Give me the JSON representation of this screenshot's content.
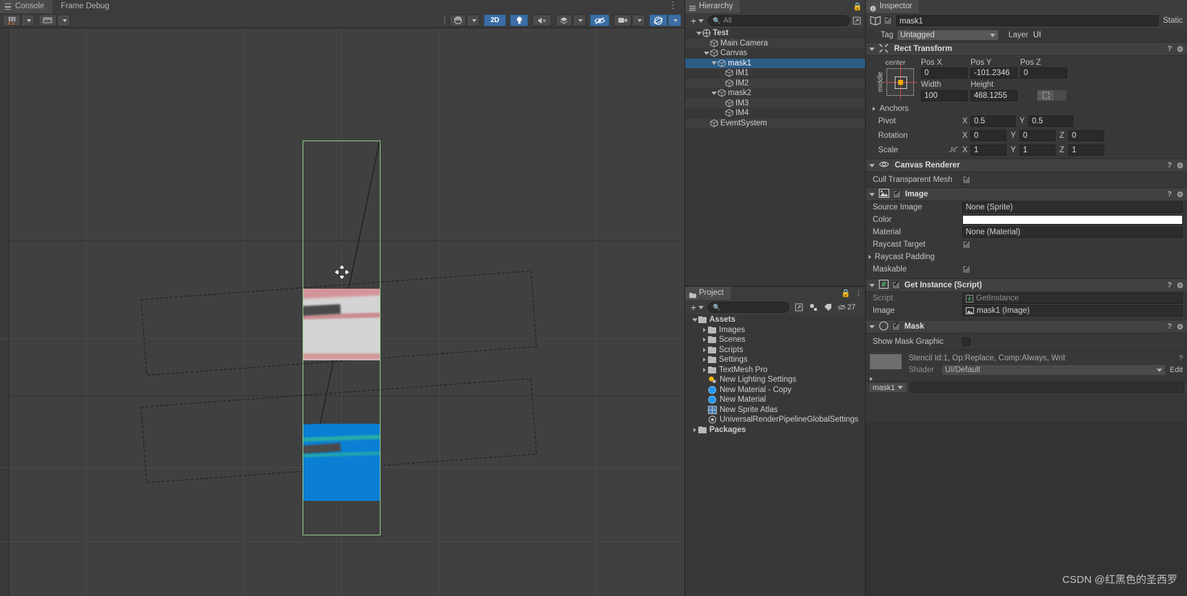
{
  "console": {
    "tabs": [
      {
        "label": "Console",
        "icon": "console-icon",
        "active": true
      },
      {
        "label": "Frame Debug",
        "icon": "",
        "active": false
      }
    ]
  },
  "scene_toolbar": {
    "left_buttons": [
      {
        "name": "snap-grid-toggle",
        "glyph": "#",
        "dropdown": true
      },
      {
        "name": "grid-snapping",
        "glyph": "|||",
        "dropdown": true
      }
    ],
    "right_buttons": [
      {
        "name": "draw-mode",
        "label": "shaded-globe",
        "dropdown": true,
        "active": false
      },
      {
        "name": "2d-toggle",
        "label": "2D",
        "active": true
      },
      {
        "name": "lighting-toggle",
        "label": "bulb",
        "active": true
      },
      {
        "name": "audio-toggle",
        "label": "audio-mute",
        "active": false
      },
      {
        "name": "effects-toggle",
        "label": "fx",
        "dropdown": true,
        "active": false
      },
      {
        "name": "hidden-objects-toggle",
        "label": "eye-off",
        "active": true
      },
      {
        "name": "camera-toggle",
        "label": "camera",
        "dropdown": true,
        "active": false
      },
      {
        "name": "gizmos-toggle",
        "label": "gizmos",
        "dropdown": true,
        "active": true
      }
    ]
  },
  "hierarchy": {
    "tab_label": "Hierarchy",
    "search_placeholder": "All",
    "add_label": "+",
    "items": [
      {
        "label": "Test",
        "depth": 0,
        "expanded": true,
        "icon": "scene-icon",
        "selected": false,
        "bold": true
      },
      {
        "label": "Main Camera",
        "depth": 1,
        "expanded": null,
        "icon": "gameobject-icon",
        "selected": false
      },
      {
        "label": "Canvas",
        "depth": 1,
        "expanded": true,
        "icon": "gameobject-icon",
        "selected": false
      },
      {
        "label": "mask1",
        "depth": 2,
        "expanded": true,
        "icon": "gameobject-icon",
        "selected": true
      },
      {
        "label": "IM1",
        "depth": 3,
        "expanded": null,
        "icon": "gameobject-icon",
        "selected": false
      },
      {
        "label": "IM2",
        "depth": 3,
        "expanded": null,
        "icon": "gameobject-icon",
        "selected": false
      },
      {
        "label": "mask2",
        "depth": 2,
        "expanded": true,
        "icon": "gameobject-icon",
        "selected": false
      },
      {
        "label": "IM3",
        "depth": 3,
        "expanded": null,
        "icon": "gameobject-icon",
        "selected": false
      },
      {
        "label": "IM4",
        "depth": 3,
        "expanded": null,
        "icon": "gameobject-icon",
        "selected": false
      },
      {
        "label": "EventSystem",
        "depth": 1,
        "expanded": null,
        "icon": "gameobject-icon",
        "selected": false
      }
    ]
  },
  "project": {
    "tab_label": "Project",
    "search_placeholder": "",
    "add_label": "+",
    "visible_count": "27",
    "items": [
      {
        "label": "Assets",
        "depth": 0,
        "expanded": true,
        "icon": "folder-icon",
        "bold": true
      },
      {
        "label": "Images",
        "depth": 1,
        "expanded": false,
        "icon": "folder-icon"
      },
      {
        "label": "Scenes",
        "depth": 1,
        "expanded": false,
        "icon": "folder-icon"
      },
      {
        "label": "Scripts",
        "depth": 1,
        "expanded": false,
        "icon": "folder-icon"
      },
      {
        "label": "Settings",
        "depth": 1,
        "expanded": false,
        "icon": "folder-icon"
      },
      {
        "label": "TextMesh Pro",
        "depth": 1,
        "expanded": false,
        "icon": "folder-icon"
      },
      {
        "label": "New Lighting Settings",
        "depth": 1,
        "expanded": null,
        "icon": "lighting-settings-icon"
      },
      {
        "label": "New Material - Copy",
        "depth": 1,
        "expanded": null,
        "icon": "material-icon"
      },
      {
        "label": "New Material",
        "depth": 1,
        "expanded": null,
        "icon": "material-icon"
      },
      {
        "label": "New Sprite Atlas",
        "depth": 1,
        "expanded": null,
        "icon": "sprite-atlas-icon"
      },
      {
        "label": "UniversalRenderPipelineGlobalSettings",
        "depth": 1,
        "expanded": null,
        "icon": "asset-icon"
      },
      {
        "label": "Packages",
        "depth": 0,
        "expanded": false,
        "icon": "folder-icon",
        "bold": true
      }
    ]
  },
  "inspector": {
    "tab_label": "Inspector",
    "object_name": "mask1",
    "object_enabled": true,
    "static_label": "Static",
    "tag_label": "Tag",
    "tag_value": "Untagged",
    "layer_label": "Layer",
    "layer_value": "UI",
    "rect_transform": {
      "title": "Rect Transform",
      "anchor_preset_top": "center",
      "anchor_preset_side": "middle",
      "headers": [
        "Pos X",
        "Pos Y",
        "Pos Z"
      ],
      "pos": [
        "0",
        "-101.2346",
        "0"
      ],
      "size_headers": [
        "Width",
        "Height"
      ],
      "size": [
        "100",
        "468.1255"
      ],
      "anchors_label": "Anchors",
      "pivot_label": "Pivot",
      "pivot": {
        "x_label": "X",
        "x": "0.5",
        "y_label": "Y",
        "y": "0.5"
      },
      "rotation_label": "Rotation",
      "rotation": {
        "x_label": "X",
        "x": "0",
        "y_label": "Y",
        "y": "0",
        "z_label": "Z",
        "z": "0"
      },
      "scale_label": "Scale",
      "scale": {
        "x_label": "X",
        "x": "1",
        "y_label": "Y",
        "y": "1",
        "z_label": "Z",
        "z": "1"
      }
    },
    "canvas_renderer": {
      "title": "Canvas Renderer",
      "cull_label": "Cull Transparent Mesh",
      "cull_checked": true
    },
    "image": {
      "title": "Image",
      "enabled": true,
      "rows": [
        {
          "label": "Source Image",
          "value": "None (Sprite)",
          "type": "object"
        },
        {
          "label": "Color",
          "value": "#FFFFFF",
          "type": "color"
        },
        {
          "label": "Material",
          "value": "None (Material)",
          "type": "object"
        },
        {
          "label": "Raycast Target",
          "value": "",
          "type": "check",
          "checked": true
        },
        {
          "label": "Raycast Padding",
          "value": "",
          "type": "foldout"
        },
        {
          "label": "Maskable",
          "value": "",
          "type": "check",
          "checked": true
        }
      ]
    },
    "get_instance": {
      "title": "Get Instance (Script)",
      "enabled": true,
      "rows": [
        {
          "label": "Script",
          "value": "GetInstance",
          "type": "object",
          "disabled": true
        },
        {
          "label": "Image",
          "value": "mask1 (Image)",
          "type": "object"
        }
      ]
    },
    "mask": {
      "title": "Mask",
      "enabled": true,
      "show_mask_graphic_label": "Show Mask Graphic",
      "show_mask_graphic_checked": false
    },
    "material_preview": {
      "title": "Stencil Id:1, Op:Replace, Comp:Always, Writ",
      "shader_label": "Shader",
      "shader_value": "UI/Default",
      "edit_label": "Edit"
    },
    "breadcrumb": "mask1"
  },
  "scene_view": {
    "selection_object": "mask1",
    "cursor": "move-cursor",
    "shapes": [
      {
        "name": "mask1-white-image",
        "color": "#d4d4d4",
        "accent": "#d98e90"
      },
      {
        "name": "mask2-blue-image",
        "color": "#0b7fd4",
        "accent": "#2ab5a0"
      }
    ]
  },
  "watermark": {
    "text": "CSDN @红黑色的圣西罗"
  },
  "colors": {
    "accent_blue": "#3b6ea5",
    "selection_blue": "#2c5d87",
    "panel_bg": "#383838",
    "header_bg": "#414141",
    "selection_green": "#93d68a"
  }
}
